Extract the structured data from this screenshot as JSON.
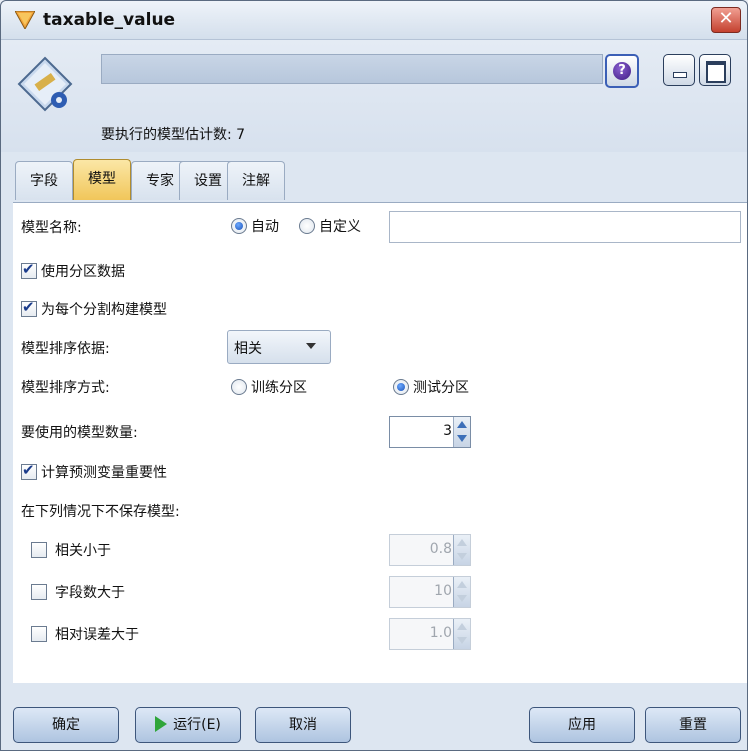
{
  "window": {
    "title": "taxable_value",
    "close_glyph": "✕"
  },
  "header": {
    "model_count_label": "要执行的模型估计数: 7",
    "help_glyph": "?"
  },
  "tabs": [
    {
      "label": "字段",
      "active": false
    },
    {
      "label": "模型",
      "active": true
    },
    {
      "label": "专家",
      "active": false
    },
    {
      "label": "设置",
      "active": false
    },
    {
      "label": "注解",
      "active": false
    }
  ],
  "model": {
    "name_label": "模型名称:",
    "name_auto": "自动",
    "name_custom": "自定义",
    "name_mode": "自动",
    "name_value": "",
    "use_partition_label": "使用分区数据",
    "use_partition_checked": true,
    "build_per_split_label": "为每个分割构建模型",
    "build_per_split_checked": true,
    "rank_by_label": "模型排序依据:",
    "rank_by_value": "相关",
    "rank_using_label": "模型排序方式:",
    "rank_train": "训练分区",
    "rank_test": "测试分区",
    "rank_using_selected": "测试分区",
    "num_models_label": "要使用的模型数量:",
    "num_models_value": "3",
    "predictor_importance_label": "计算预测变量重要性",
    "predictor_importance_checked": true,
    "discard_label": "在下列情况下不保存模型:",
    "discard": [
      {
        "label": "相关小于",
        "checked": false,
        "value": "0.8"
      },
      {
        "label": "字段数大于",
        "checked": false,
        "value": "10"
      },
      {
        "label": "相对误差大于",
        "checked": false,
        "value": "1.0"
      }
    ]
  },
  "footer": {
    "ok": "确定",
    "run": "运行(E)",
    "cancel": "取消",
    "apply": "应用",
    "reset": "重置"
  },
  "colors": {
    "accent": "#f1c65a",
    "window_bg": "#dde6f1",
    "close": "#c4412f"
  }
}
